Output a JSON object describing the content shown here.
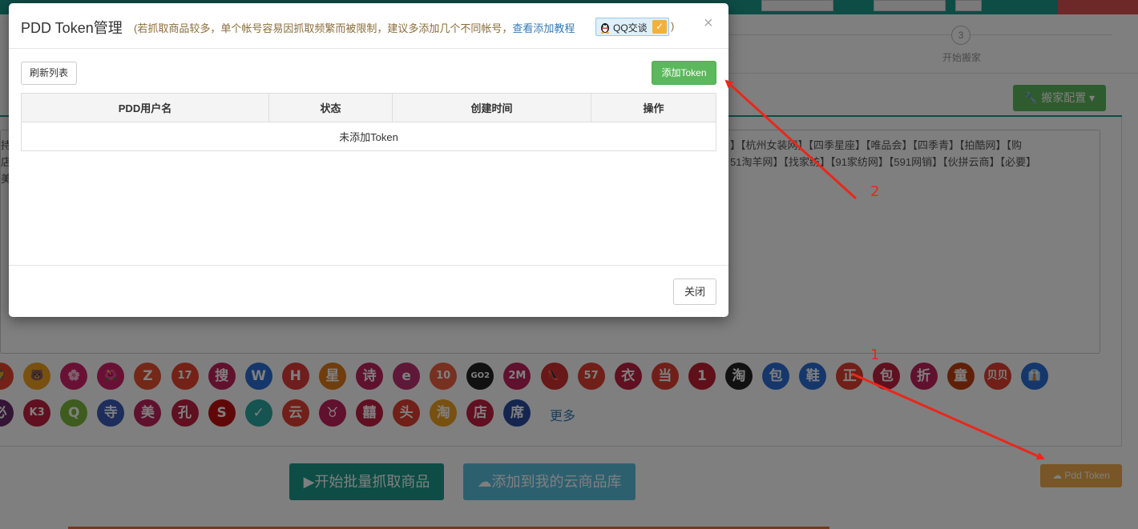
{
  "modal": {
    "title": "PDD Token管理",
    "note_prefix": "(若抓取商品较多，单个帐号容易因抓取频繁而被限制，建议多添加几个不同帐号，",
    "tutorial_link": "查看添加教程",
    "qq_label": "QQ交谈",
    "note_suffix": ")",
    "close_icon": "×",
    "refresh_label": "刷新列表",
    "add_token_label": "添加Token",
    "table": {
      "headers": [
        "PDD用户名",
        "状态",
        "创建时间",
        "操作"
      ],
      "empty_text": "未添加Token"
    },
    "close_label": "关闭"
  },
  "background": {
    "step3_number": "3",
    "step3_label": "开始搬家",
    "config_button": "搬家配置",
    "sites_line1": "】【杭州女装网】【四季星座】【唯品会】【四季青】【拍酷网】【购",
    "sites_line2": "51淘羊网】【找家纺】【91家纺网】【591网销】【伙拼云商】【必要】",
    "left_frag": [
      "持",
      "店",
      "美"
    ],
    "site_icons_row1": [
      "🦁",
      "🐻",
      "🌸",
      "🌺",
      "Z",
      "17",
      "搜",
      "W",
      "H",
      "星",
      "诗",
      "e",
      "10",
      "GO2",
      "2M",
      "👠",
      "57",
      "衣",
      "当",
      "1",
      "淘",
      "包",
      "鞋",
      "正",
      "包",
      "折",
      "童",
      "贝贝",
      "👔"
    ],
    "site_icons_row2": [
      "必",
      "K3",
      "Q",
      "寺",
      "美",
      "孔",
      "S",
      "✓",
      "云",
      "♉",
      "囍",
      "头",
      "淘",
      "店",
      "席"
    ],
    "more_label": "更多",
    "grab_button": "▶开始批量抓取商品",
    "cloud_button": "添加到我的云商品库",
    "pdd_token_button": "Pdd Token"
  },
  "annotations": {
    "label1": "1",
    "label2": "2",
    "arrow_color": "#e8281b"
  },
  "colors": {
    "teal": "#1a9a8c",
    "green": "#5cb85c",
    "orange": "#f0ad4e",
    "cyan": "#5bc0de",
    "note": "#8a6d3b",
    "link": "#337ab7"
  }
}
